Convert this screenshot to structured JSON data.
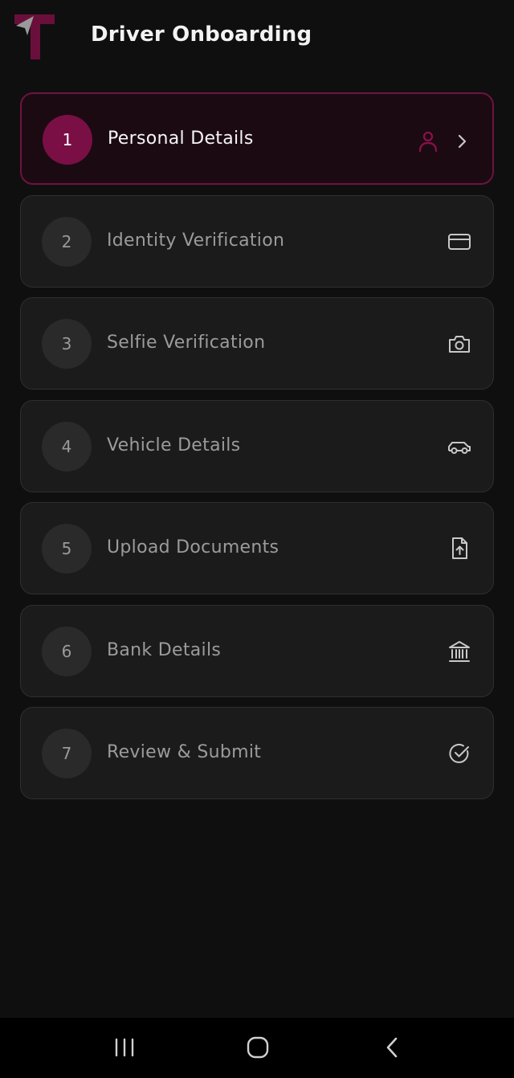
{
  "app": {
    "title": "Driver Onboarding"
  },
  "colors": {
    "brand": "#7a0f45",
    "active_border": "#6e1340",
    "background": "#0f0f0f",
    "card": "#1b1b1b",
    "muted_text": "#9b9b9b"
  },
  "steps": [
    {
      "number": "1",
      "label": "Personal Details",
      "icon": "person-icon",
      "active": true
    },
    {
      "number": "2",
      "label": "Identity Verification",
      "icon": "id-card-icon",
      "active": false
    },
    {
      "number": "3",
      "label": "Selfie Verification",
      "icon": "camera-icon",
      "active": false
    },
    {
      "number": "4",
      "label": "Vehicle Details",
      "icon": "car-icon",
      "active": false
    },
    {
      "number": "5",
      "label": "Upload Documents",
      "icon": "file-upload-icon",
      "active": false
    },
    {
      "number": "6",
      "label": "Bank Details",
      "icon": "bank-icon",
      "active": false
    },
    {
      "number": "7",
      "label": "Review & Submit",
      "icon": "check-circle-icon",
      "active": false
    }
  ],
  "navbar": {
    "buttons": [
      "recent-apps-icon",
      "home-icon",
      "back-icon"
    ]
  }
}
